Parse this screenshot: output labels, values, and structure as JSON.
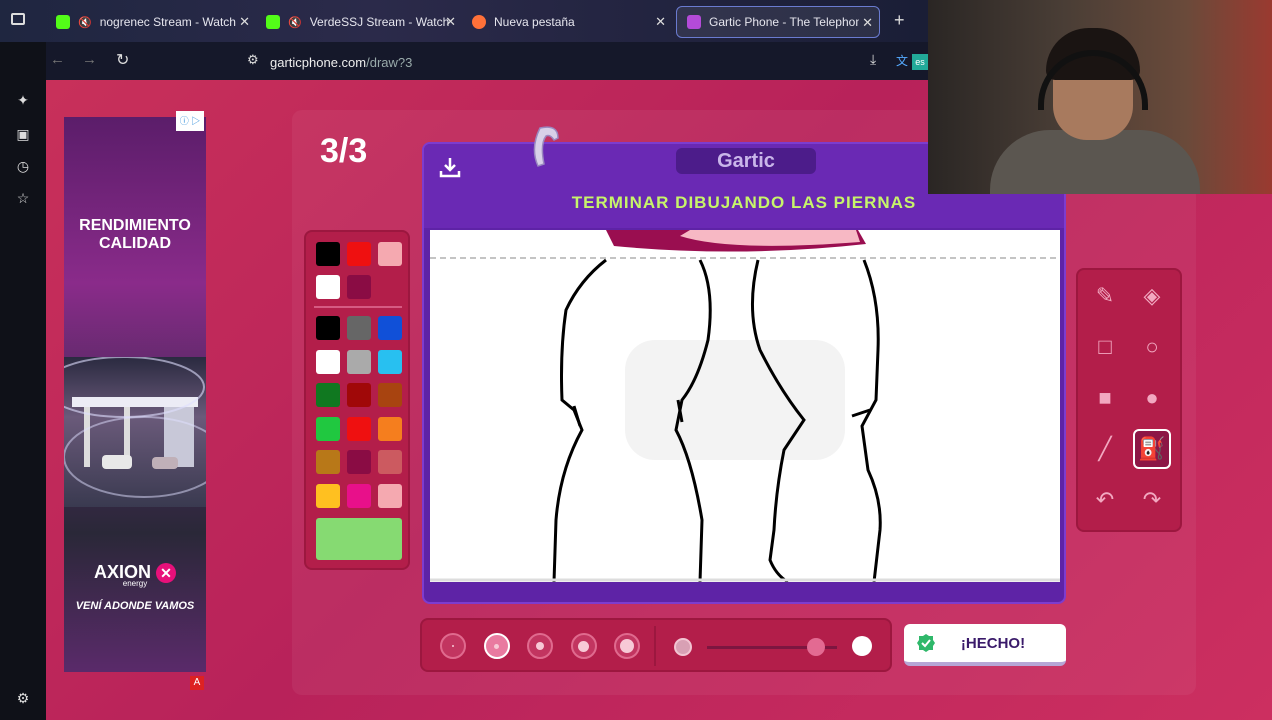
{
  "browser": {
    "tabs": [
      {
        "label": "nogrenec Stream - Watch L",
        "icon": "kick-icon",
        "color": "#53fc18"
      },
      {
        "label": "VerdeSSJ Stream - Watch L",
        "icon": "kick-icon",
        "color": "#53fc18"
      },
      {
        "label": "Nueva pestaña",
        "icon": "firefox-icon",
        "color": "#ff7139"
      },
      {
        "label": "Gartic Phone - The Telephone C",
        "icon": "phone-icon",
        "color": "#b44bd8"
      }
    ],
    "url_host": "garticphone.com",
    "url_path": "/draw?3",
    "lang_badge": "es"
  },
  "ad": {
    "title_line1": "RENDIMIENTO",
    "title_line2": "CALIDAD",
    "brand": "AXION",
    "brand_sub": "energy",
    "slogan": "VENÍ ADONDE VAMOS",
    "badge": "A"
  },
  "game": {
    "round": "3/3",
    "logo": "Gartic",
    "prompt": "TERMINAR DIBUJANDO LAS PIERNAS",
    "done_label": "¡HECHO!",
    "selected_color": "#86da72",
    "palette_top": [
      "#000000",
      "#ef1010",
      "#f5a9b0",
      "#ffffff",
      "#8a0c44"
    ],
    "palette": [
      "#000000",
      "#666666",
      "#1050d8",
      "#ffffff",
      "#aaaaaa",
      "#28c0f0",
      "#107820",
      "#a00808",
      "#a84410",
      "#20c840",
      "#ef1010",
      "#f57e1e",
      "#b87818",
      "#8a0c44",
      "#cc5a60",
      "#ffc020",
      "#e8108a",
      "#f5a9b0"
    ],
    "tools": [
      "pencil-icon",
      "eraser-icon",
      "rect-outline-icon",
      "circle-outline-icon",
      "rect-fill-icon",
      "circle-fill-icon",
      "line-icon",
      "fill-bucket-icon",
      "undo-icon",
      "redo-icon"
    ],
    "selected_tool": "fill-bucket-icon",
    "brush_sizes": 5,
    "selected_size_index": 1,
    "opacity": 0.84
  }
}
